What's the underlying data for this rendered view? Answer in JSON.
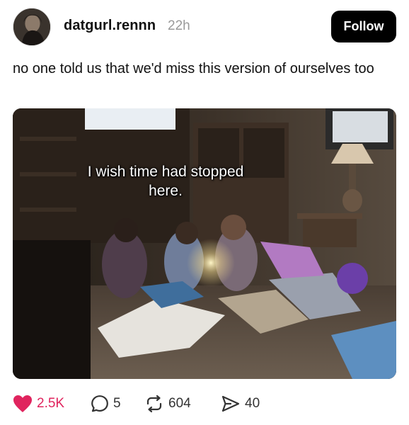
{
  "post": {
    "username": "datgurl.rennn",
    "time_ago": "22h",
    "follow_label": "Follow",
    "caption": "no one told us that we'd miss this version of ourselves too",
    "image": {
      "overlay_text": "I wish time had stopped\nhere."
    }
  },
  "actions": {
    "likes": "2.5K",
    "comments": "5",
    "reposts": "604",
    "shares": "40"
  },
  "colors": {
    "like": "#e0245e",
    "follow_bg": "#000000",
    "muted": "#999999"
  },
  "icons": [
    "heart-icon",
    "comment-icon",
    "repost-icon",
    "share-icon"
  ]
}
